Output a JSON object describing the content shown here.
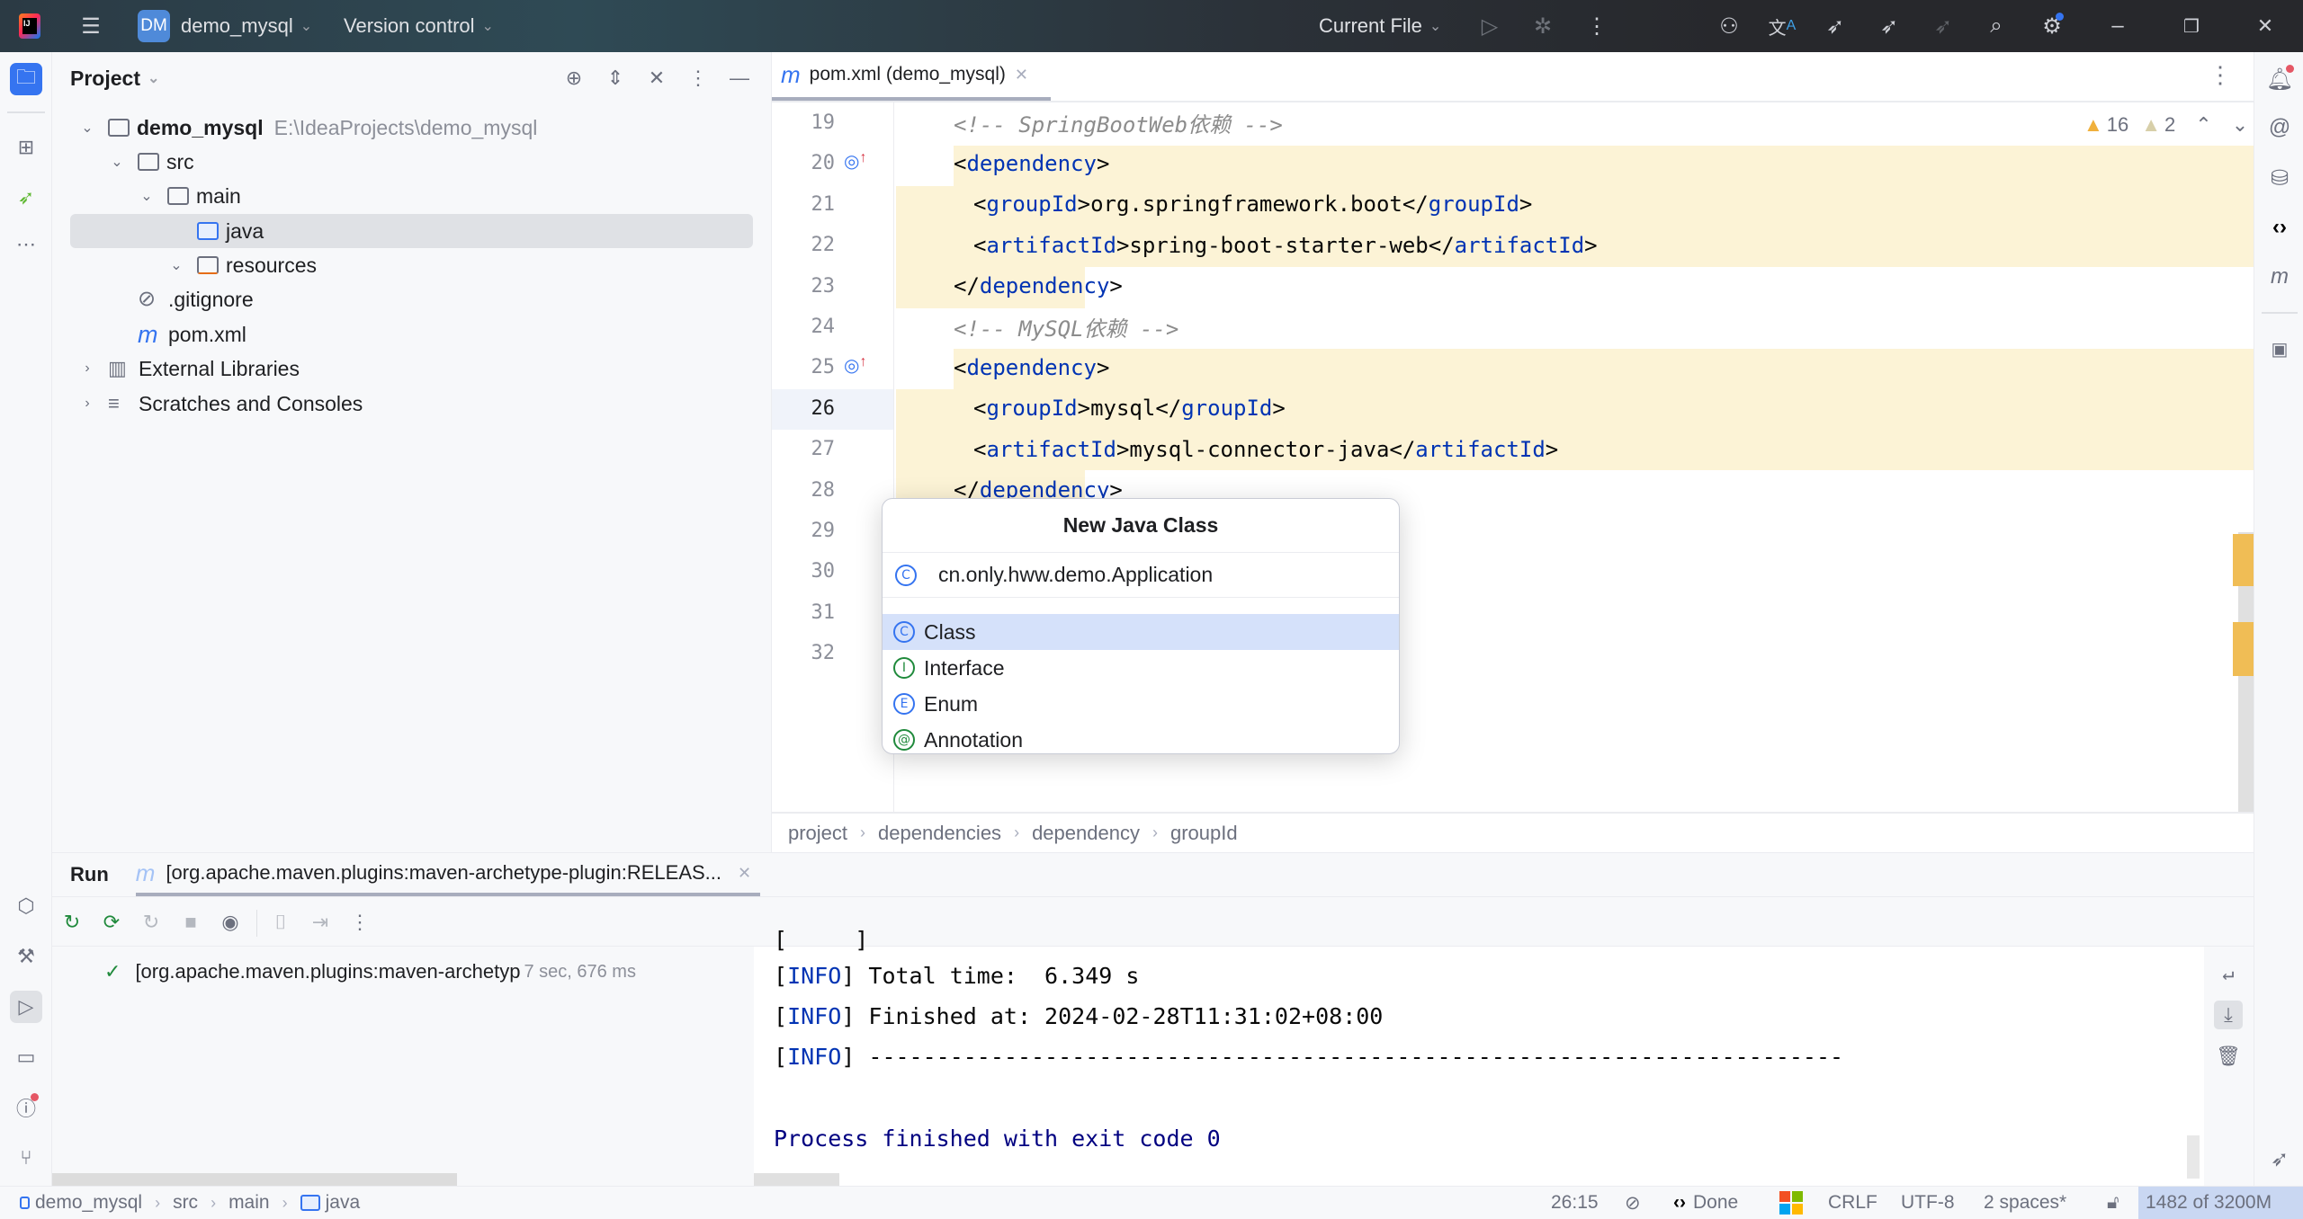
{
  "titlebar": {
    "project_badge": "DM",
    "project_name": "demo_mysql",
    "vcs": "Version control",
    "run_config": "Current File"
  },
  "project_panel": {
    "title": "Project",
    "tree": [
      {
        "label": "demo_mysql",
        "hint": "E:\\IdeaProjects\\demo_mysql",
        "level": 0,
        "expanded": true,
        "icon": "module-folder-icon"
      },
      {
        "label": "src",
        "level": 1,
        "expanded": true,
        "icon": "folder-icon"
      },
      {
        "label": "main",
        "level": 2,
        "expanded": true,
        "icon": "folder-icon"
      },
      {
        "label": "java",
        "level": 3,
        "selected": true,
        "icon": "source-folder-icon"
      },
      {
        "label": "resources",
        "level": 3,
        "expanded": true,
        "icon": "resources-folder-icon"
      },
      {
        "label": ".gitignore",
        "level": 1,
        "icon": "ignore-file-icon"
      },
      {
        "label": "pom.xml",
        "level": 1,
        "icon": "maven-icon"
      },
      {
        "label": "External Libraries",
        "level": 0,
        "expanded": false,
        "icon": "library-icon"
      },
      {
        "label": "Scratches and Consoles",
        "level": 0,
        "expanded": false,
        "icon": "scratches-icon"
      }
    ]
  },
  "editor": {
    "tab_label": "pom.xml (demo_mysql)",
    "warnings": "16",
    "weak_warnings": "2",
    "lines": [
      {
        "n": "19",
        "text": "<!-- SpringBootWeb依赖 -->"
      },
      {
        "n": "20",
        "text": "<dependency>"
      },
      {
        "n": "21",
        "text": "<groupId>org.springframework.boot</groupId>"
      },
      {
        "n": "22",
        "text": "<artifactId>spring-boot-starter-web</artifactId>"
      },
      {
        "n": "23",
        "text": "</dependency>"
      },
      {
        "n": "24",
        "text": "<!-- MySQL依赖 -->"
      },
      {
        "n": "25",
        "text": "<dependency>"
      },
      {
        "n": "26",
        "text": "<groupId>mysql</groupId>"
      },
      {
        "n": "27",
        "text": "<artifactId>mysql-connector-java</artifactId>"
      },
      {
        "n": "28",
        "text": "</dependency>"
      },
      {
        "n": "29",
        "text": ""
      },
      {
        "n": "30",
        "text": ""
      },
      {
        "n": "31",
        "text": ""
      },
      {
        "n": "32",
        "text": ""
      }
    ],
    "breadcrumb": [
      "project",
      "dependencies",
      "dependency",
      "groupId"
    ]
  },
  "dialog": {
    "title": "New Java Class",
    "input_value": "cn.only.hww.demo.Application",
    "kinds": [
      {
        "label": "Class",
        "glyph": "C",
        "selected": true
      },
      {
        "label": "Interface",
        "glyph": "I"
      },
      {
        "label": "Enum",
        "glyph": "E"
      },
      {
        "label": "Annotation",
        "glyph": "@"
      }
    ]
  },
  "run": {
    "title": "Run",
    "tab_label": "[org.apache.maven.plugins:maven-archetype-plugin:RELEAS...",
    "tree_item": "[org.apache.maven.plugins:maven-archetyp",
    "tree_item_time": "7 sec, 676 ms",
    "console": {
      "info_tag": "INFO",
      "line1": " Total time:  6.349 s",
      "line2": " Finished at: 2024-02-28T11:31:02+08:00",
      "line3": " ------------------------------------------------------------------------",
      "exit": "Process finished with exit code 0"
    }
  },
  "status": {
    "breadcrumb": [
      "demo_mysql",
      "src",
      "main",
      "java"
    ],
    "position": "26:15",
    "ai_status": "Done",
    "line_sep": "CRLF",
    "encoding": "UTF-8",
    "indent": "2 spaces*",
    "memory": "1482 of 3200M"
  }
}
